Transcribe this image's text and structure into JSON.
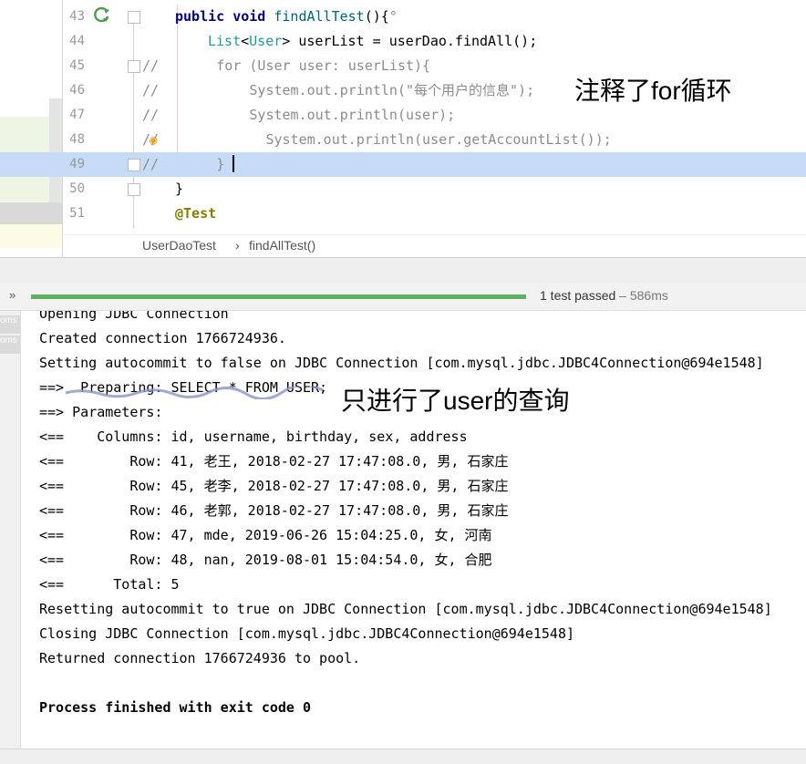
{
  "editor": {
    "line_numbers": [
      "43",
      "44",
      "45",
      "46",
      "47",
      "48",
      "49",
      "50",
      "51"
    ],
    "lines": [
      {
        "parts": [
          {
            "t": "public ",
            "c": "kw"
          },
          {
            "t": "void ",
            "c": "kw"
          },
          {
            "t": "findAllTest",
            "c": "method"
          },
          {
            "t": "(){",
            "c": ""
          },
          {
            "t": "°",
            "c": "cmt"
          }
        ],
        "indent": "    "
      },
      {
        "parts": [
          {
            "t": "List",
            "c": "ty"
          },
          {
            "t": "<",
            "c": ""
          },
          {
            "t": "User",
            "c": "ty"
          },
          {
            "t": "> userList = ",
            "c": ""
          },
          {
            "t": "userDao",
            "c": ""
          },
          {
            "t": ".findAll();",
            "c": ""
          }
        ],
        "indent": "      "
      },
      {
        "parts": [
          {
            "t": "//       for (User user: userList){",
            "c": "cmt"
          }
        ],
        "indent": ""
      },
      {
        "parts": [
          {
            "t": "//           System.out.println(\"每个用户的信息\");",
            "c": "cmt"
          }
        ],
        "indent": ""
      },
      {
        "parts": [
          {
            "t": "//           System.out.println(user);",
            "c": "cmt"
          }
        ],
        "indent": ""
      },
      {
        "parts": [
          {
            "t": "//             System.out.println(user.getAccountList());",
            "c": "cmt"
          }
        ],
        "indent": ""
      },
      {
        "parts": [
          {
            "t": "//       }",
            "c": "cmt"
          }
        ],
        "indent": ""
      },
      {
        "parts": [
          {
            "t": "}",
            "c": ""
          }
        ],
        "indent": "    "
      },
      {
        "parts": [
          {
            "t": "@Test",
            "c": "ann"
          }
        ],
        "indent": "    "
      }
    ],
    "note": "注释了for循环",
    "breadcrumb": {
      "file": "UserDaoTest",
      "sep": "›",
      "method": "findAllTest()"
    }
  },
  "run": {
    "toggle": "»",
    "status": "1 test passed",
    "time": " – 586ms",
    "progress": 1.0
  },
  "console": {
    "side_tabs": [
      "oms",
      "oms"
    ],
    "lines": [
      {
        "text": "Opening JDBC Connection",
        "bold": false
      },
      {
        "text": "Created connection 1766724936.",
        "bold": false
      },
      {
        "text": "Setting autocommit to false on JDBC Connection [com.mysql.jdbc.JDBC4Connection@694e1548]",
        "bold": false
      },
      {
        "text": "==>  Preparing: SELECT * FROM USER;",
        "bold": false
      },
      {
        "text": "==> Parameters: ",
        "bold": false
      },
      {
        "text": "<==    Columns: id, username, birthday, sex, address",
        "bold": false
      },
      {
        "text": "<==        Row: 41, 老王, 2018-02-27 17:47:08.0, 男, 石家庄",
        "bold": false
      },
      {
        "text": "<==        Row: 45, 老李, 2018-02-27 17:47:08.0, 男, 石家庄",
        "bold": false
      },
      {
        "text": "<==        Row: 46, 老郭, 2018-02-27 17:47:08.0, 男, 石家庄",
        "bold": false
      },
      {
        "text": "<==        Row: 47, mde, 2019-06-26 15:04:25.0, 女, 河南",
        "bold": false
      },
      {
        "text": "<==        Row: 48, nan, 2019-08-01 15:04:54.0, 女, 合肥",
        "bold": false
      },
      {
        "text": "<==      Total: 5",
        "bold": false
      },
      {
        "text": "Resetting autocommit to true on JDBC Connection [com.mysql.jdbc.JDBC4Connection@694e1548]",
        "bold": false
      },
      {
        "text": "Closing JDBC Connection [com.mysql.jdbc.JDBC4Connection@694e1548]",
        "bold": false
      },
      {
        "text": "Returned connection 1766724936 to pool.",
        "bold": false
      },
      {
        "text": "",
        "bold": false
      },
      {
        "text": "Process finished with exit code 0",
        "bold": true
      }
    ],
    "note": "只进行了user的查询"
  },
  "colors": {
    "progress": "#5ab15f",
    "highlight_line": "#c6dcf6",
    "keyword": "#000080",
    "comment": "#8c8c8c"
  }
}
